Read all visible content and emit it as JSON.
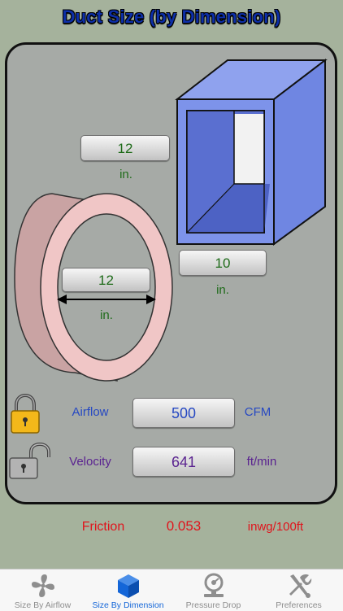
{
  "title": "Duct Size (by Dimension)",
  "rect_duct": {
    "height_value": "12",
    "height_unit": "in.",
    "width_value": "10",
    "width_unit": "in."
  },
  "round_duct": {
    "diameter_value": "12",
    "diameter_unit": "in."
  },
  "airflow": {
    "label": "Airflow",
    "value": "500",
    "unit": "CFM",
    "locked": true
  },
  "velocity": {
    "label": "Velocity",
    "value": "641",
    "unit": "ft/min",
    "locked": false
  },
  "friction": {
    "label": "Friction",
    "value": "0.053",
    "unit": "inwg/100ft"
  },
  "tabs": [
    {
      "label": "Size By Airflow",
      "icon": "fan-icon",
      "active": false
    },
    {
      "label": "Size By Dimension",
      "icon": "cube-icon",
      "active": true
    },
    {
      "label": "Pressure Drop",
      "icon": "gauge-icon",
      "active": false
    },
    {
      "label": "Preferences",
      "icon": "tools-icon",
      "active": false
    }
  ],
  "colors": {
    "background": "#a5b29c",
    "panel": "#a6aaa6",
    "title": "#0d2fa8",
    "dimension_text": "#1e6b19",
    "airflow_text": "#2749c2",
    "velocity_text": "#5a2390",
    "friction_text": "#e0141c",
    "duct_blue": "#7f94e6",
    "round_duct_pink": "#efc4c4",
    "tab_active": "#1466d8"
  }
}
